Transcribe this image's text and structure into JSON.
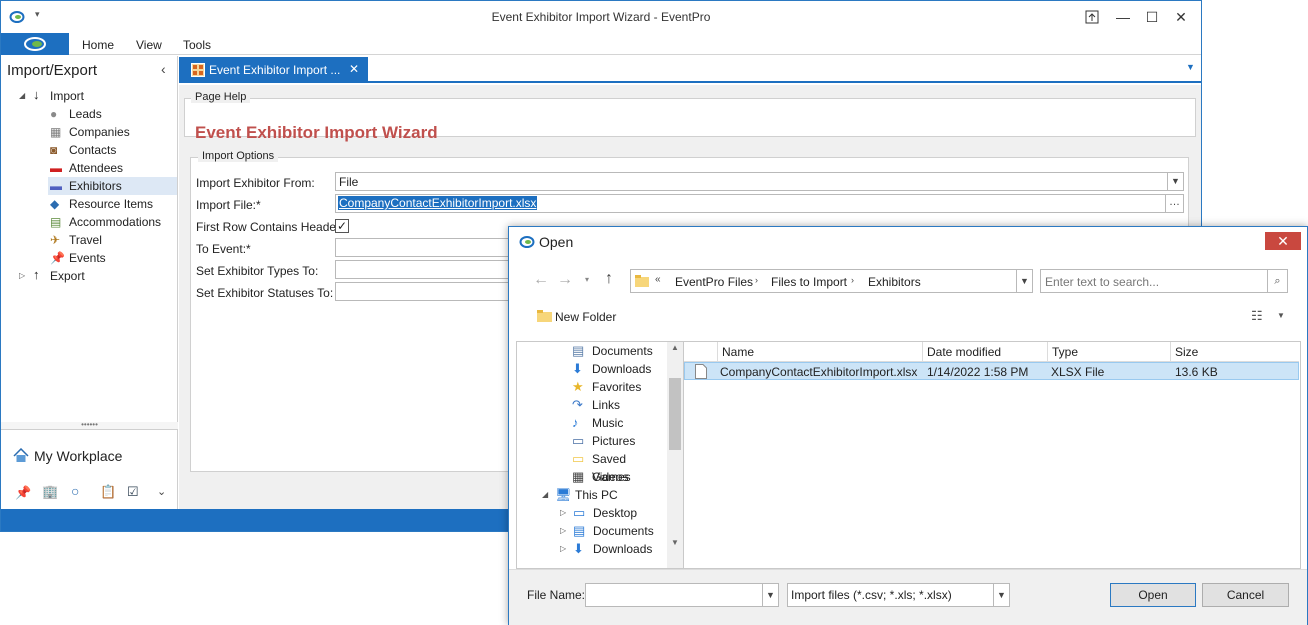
{
  "window": {
    "title": "Event Exhibitor Import Wizard - EventPro"
  },
  "ribbon": {
    "tabs": [
      "Home",
      "View",
      "Tools"
    ]
  },
  "nav": {
    "title": "Import/Export",
    "import_label": "Import",
    "items": [
      "Leads",
      "Companies",
      "Contacts",
      "Attendees",
      "Exhibitors",
      "Resource Items",
      "Accommodations",
      "Travel",
      "Events"
    ],
    "export_label": "Export",
    "workplace": "My Workplace"
  },
  "doc_tab": {
    "label": "Event Exhibitor Import ..."
  },
  "page_help": {
    "legend": "Page Help",
    "title": "Event Exhibitor Import Wizard"
  },
  "import_options": {
    "legend": "Import Options",
    "fields": {
      "from_label": "Import Exhibitor From:",
      "from_value": "File",
      "file_label": "Import File:*",
      "file_value": "CompanyContactExhibitorImport.xlsx",
      "headers_label": "First Row Contains Headers",
      "event_label": "To Event:*",
      "types_label": "Set Exhibitor Types To:",
      "statuses_label": "Set Exhibitor Statuses To:"
    }
  },
  "dialog": {
    "title": "Open",
    "breadcrumb": [
      "EventPro Files",
      "Files to Import",
      "Exhibitors"
    ],
    "search_placeholder": "Enter text to search...",
    "new_folder": "New Folder",
    "left_items": [
      "Documents",
      "Downloads",
      "Favorites",
      "Links",
      "Music",
      "Pictures",
      "Saved Games",
      "Videos"
    ],
    "this_pc": "This PC",
    "pc_items": [
      "Desktop",
      "Documents",
      "Downloads"
    ],
    "columns": [
      "Name",
      "Date modified",
      "Type",
      "Size"
    ],
    "files": [
      {
        "name": "CompanyContactExhibitorImport.xlsx",
        "date": "1/14/2022 1:58 PM",
        "type": "XLSX File",
        "size": "13.6 KB"
      }
    ],
    "file_name_label": "File Name:",
    "filter": "Import files (*.csv; *.xls; *.xlsx)",
    "open_button": "Open",
    "cancel_button": "Cancel"
  },
  "colors": {
    "accent": "#1d6fc0",
    "title_red": "#c0504d",
    "selection": "#cce4f7"
  }
}
